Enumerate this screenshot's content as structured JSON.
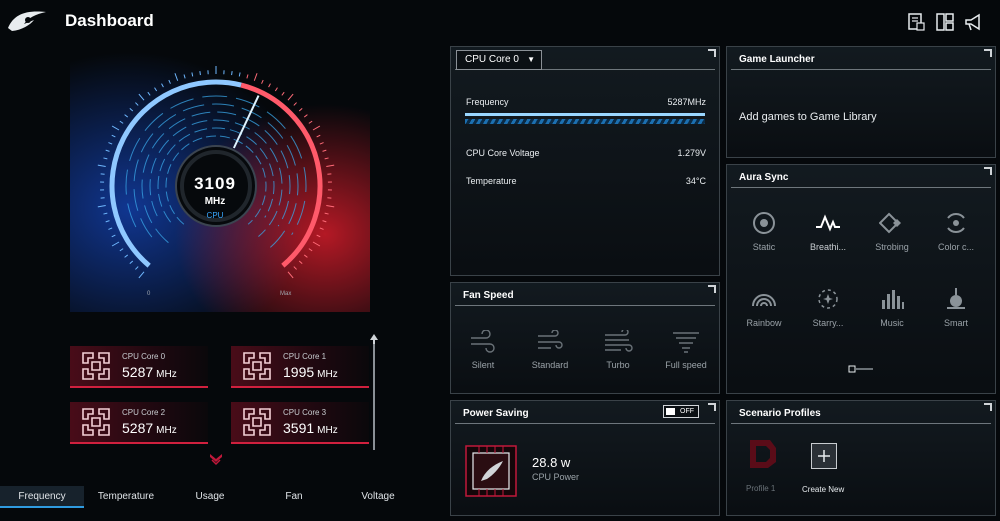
{
  "app": {
    "title": "Dashboard"
  },
  "header": {
    "icons": [
      "report-icon",
      "layout-icon",
      "announcement-icon"
    ]
  },
  "gauge": {
    "value": "3109",
    "unit": "MHz",
    "label": "CPU",
    "min_label": "0",
    "max_label": "Max",
    "level_fraction": 0.59
  },
  "cores": [
    {
      "name": "CPU Core 0",
      "value": "5287",
      "unit": "MHz"
    },
    {
      "name": "CPU Core 1",
      "value": "1995",
      "unit": "MHz"
    },
    {
      "name": "CPU Core 2",
      "value": "5287",
      "unit": "MHz"
    },
    {
      "name": "CPU Core 3",
      "value": "3591",
      "unit": "MHz"
    }
  ],
  "bottom_tabs": [
    {
      "label": "Frequency",
      "active": true
    },
    {
      "label": "Temperature",
      "active": false
    },
    {
      "label": "Usage",
      "active": false
    },
    {
      "label": "Fan",
      "active": false
    },
    {
      "label": "Voltage",
      "active": false
    }
  ],
  "cpu_panel": {
    "selected_core": "CPU Core 0",
    "frequency_label": "Frequency",
    "frequency_value": "5287MHz",
    "frequency_fraction": 1.0,
    "voltage_label": "CPU Core Voltage",
    "voltage_value": "1.279V",
    "temp_label": "Temperature",
    "temp_value": "34°C"
  },
  "fan_panel": {
    "title": "Fan Speed",
    "modes": [
      "Silent",
      "Standard",
      "Turbo",
      "Full speed"
    ]
  },
  "power_panel": {
    "title": "Power Saving",
    "toggle_label": "OFF",
    "value": "28.8 w",
    "label": "CPU Power"
  },
  "game_panel": {
    "title": "Game Launcher",
    "message": "Add games to Game Library"
  },
  "aura_panel": {
    "title": "Aura Sync",
    "effects": [
      "Static",
      "Breathi...",
      "Strobing",
      "Color c...",
      "Rainbow",
      "Starry...",
      "Music",
      "Smart"
    ],
    "selected": "Breathi..."
  },
  "scenario_panel": {
    "title": "Scenario Profiles",
    "profile_label": "Profile 1",
    "create_label": "Create New"
  },
  "colors": {
    "accent_blue": "#2f9be0",
    "accent_red": "#d0203e"
  }
}
